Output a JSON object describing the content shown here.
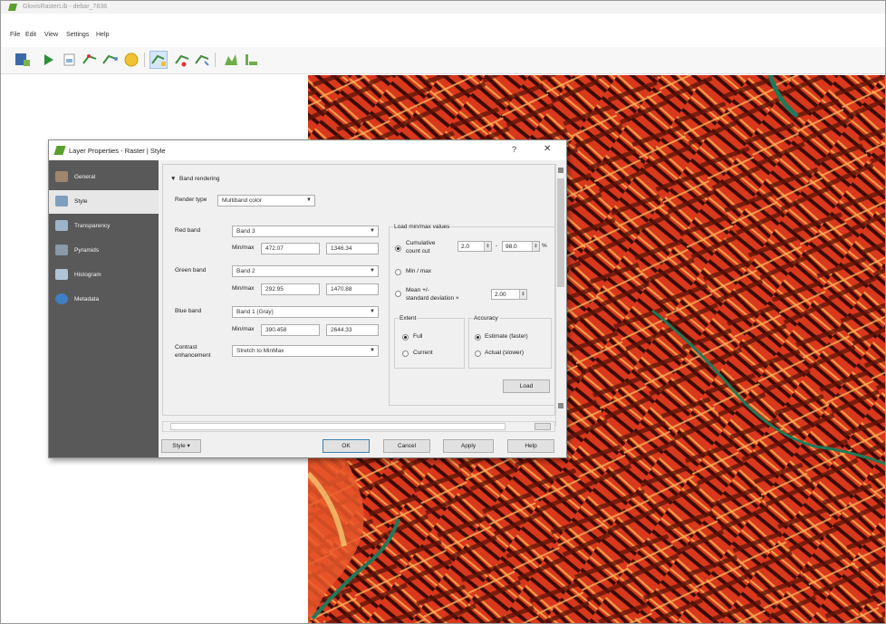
{
  "window": {
    "title": "GlovisRasterLib - debar_7838"
  },
  "menu": {
    "file": "File",
    "edit": "Edit",
    "view": "View",
    "settings": "Settings",
    "help": "Help"
  },
  "dialog": {
    "title": "Layer Properties - Raster | Style",
    "help_glyph": "?",
    "close_glyph": "✕",
    "sidebar": [
      {
        "label": "General",
        "icon": "wrench-icon"
      },
      {
        "label": "Style",
        "icon": "brush-icon"
      },
      {
        "label": "Transparency",
        "icon": "transparency-icon"
      },
      {
        "label": "Pyramids",
        "icon": "pyramids-icon"
      },
      {
        "label": "Histogram",
        "icon": "histogram-icon"
      },
      {
        "label": "Metadata",
        "icon": "info-icon"
      }
    ],
    "band_rendering": {
      "header": "Band rendering",
      "render_type_label": "Render type",
      "render_type": "Multiband color",
      "red_label": "Red band",
      "red_value": "Band 3",
      "green_label": "Green band",
      "green_value": "Band 2",
      "blue_label": "Blue band",
      "blue_value": "Band 1 (Gray)",
      "minmax_label": "Min/max",
      "red_min": "472.07",
      "red_max": "1346.34",
      "green_min": "292.95",
      "green_max": "1470.88",
      "blue_min": "390.458",
      "blue_max": "2644.33",
      "contrast_label_1": "Contrast",
      "contrast_label_2": "enhancement",
      "contrast_value": "Stretch to MinMax"
    },
    "load_minmax": {
      "title": "Load min/max values",
      "cumulative_1": "Cumulative",
      "cumulative_2": "count cut",
      "cum_low": "2.0",
      "cum_dash": "-",
      "cum_high": "98.0",
      "cum_unit": "%",
      "minmax": "Min / max",
      "mean_1": "Mean +/-",
      "mean_2": "standard deviation ×",
      "mean_value": "2.00",
      "extent_title": "Extent",
      "extent_full": "Full",
      "extent_current": "Current",
      "accuracy_title": "Accuracy",
      "accuracy_estimate": "Estimate (faster)",
      "accuracy_actual": "Actual (slower)",
      "load_button": "Load"
    },
    "buttons": {
      "style": "Style",
      "ok": "OK",
      "cancel": "Cancel",
      "apply": "Apply",
      "help": "Help"
    }
  }
}
